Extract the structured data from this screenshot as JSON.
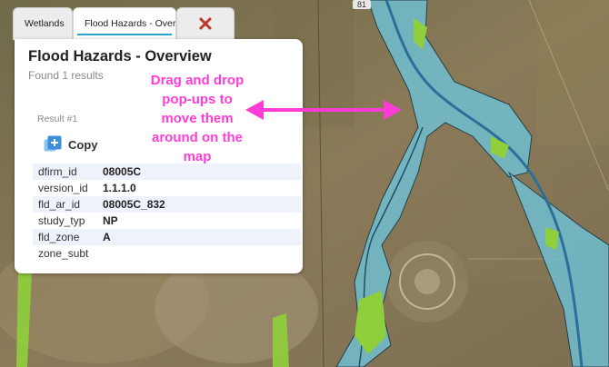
{
  "map": {
    "road_label": "81",
    "colors": {
      "terrain": "#7d7152",
      "flood_zone": "#6fc3d8",
      "vegetation": "#8fcf3c",
      "channel": "#2b6f9a"
    }
  },
  "tabs": [
    {
      "label": "Wetlands",
      "active": false
    },
    {
      "label": "Flood Hazards - Overview",
      "active": true
    }
  ],
  "close_tab": {
    "icon": "close-icon",
    "glyph": "✕",
    "color": "#c0392b"
  },
  "popup": {
    "title": "Flood Hazards - Overview",
    "found_text": "Found 1 results",
    "result_label": "Result #1",
    "copy_label": "Copy",
    "copy_icon": "copy-icon",
    "attributes": [
      {
        "key": "dfirm_id",
        "value": "08005C"
      },
      {
        "key": "version_id",
        "value": "1.1.1.0"
      },
      {
        "key": "fld_ar_id",
        "value": "08005C_832"
      },
      {
        "key": "study_typ",
        "value": "NP"
      },
      {
        "key": "fld_zone",
        "value": "A"
      },
      {
        "key": "zone_subt",
        "value": ""
      }
    ]
  },
  "annotation": {
    "text_lines": [
      "Drag and drop",
      "pop-ups to",
      "move them",
      "around on the",
      "map"
    ],
    "color": "#ff3cd6"
  }
}
